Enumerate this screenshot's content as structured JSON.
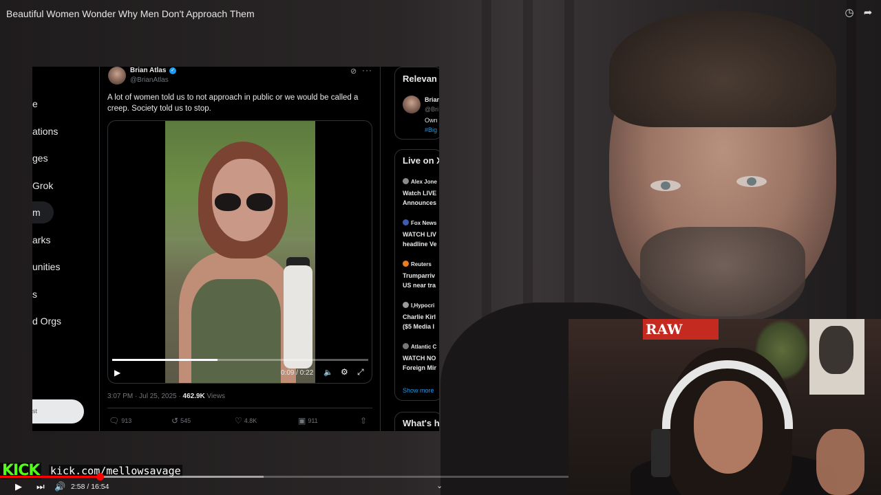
{
  "video": {
    "title": "Beautiful Women Wonder Why Men Don't Approach Them",
    "watch_later_icon": "clock-icon",
    "share_icon": "share-arrow-icon"
  },
  "x_sidebar": {
    "items": [
      "e",
      "ations",
      "ges",
      "Grok",
      "m",
      "arks",
      "unities",
      "s",
      "d Orgs"
    ],
    "post_button": "st"
  },
  "tweet": {
    "author_name": "Brian Atlas",
    "author_handle": "@BrianAtlas",
    "text": "A lot of women told us to not approach in public or we would be called a creep. Society told us to stop.",
    "video_time": "0:09 / 0:22",
    "video_progress": 0.41,
    "timestamp": "3:07 PM · Jul 25, 2025 · ",
    "views_count": "462.9K",
    "views_label": " Views",
    "replies": "913",
    "reposts": "545",
    "likes": "4.8K",
    "bookmarks": "911"
  },
  "right_column": {
    "relevant_heading": "Relevan",
    "relevant_name": "Brian",
    "relevant_handle": "@Bri",
    "relevant_bio": "Own",
    "relevant_tag": "#Big",
    "live_heading": "Live on X",
    "live_items": [
      {
        "source": "Alex Jone",
        "line1": "Watch LIVE",
        "line2": "Announces",
        "dot_color": "#8b8b8b"
      },
      {
        "source": "Fox News",
        "line1": "WATCH LIV",
        "line2": "headline Ve",
        "dot_color": "#3b5bb5"
      },
      {
        "source": "Reuters",
        "line1": "Trumparriv",
        "line2": "US near tra",
        "dot_color": "#f07b1a"
      },
      {
        "source": "I,Hypocri",
        "line1": "Charlie Kirl",
        "line2": "($5 Media I",
        "dot_color": "#9a9a9a"
      },
      {
        "source": "Atlantic C",
        "line1": "WATCH NO",
        "line2": "Foreign Mir",
        "dot_color": "#777777"
      }
    ],
    "show_more": "Show more",
    "whats_heading": "What's h"
  },
  "webcam": {
    "sign_text": "RAW"
  },
  "player": {
    "kick_logo": "KICK",
    "kick_url": "kick.com/mellowsavage",
    "time": "2:58 / 16:54",
    "played_fraction": 0.176,
    "buffered_fraction": 0.464
  },
  "colors": {
    "kick_green": "#53fc18",
    "youtube_red": "#ff0000",
    "x_blue": "#1d9bf0"
  }
}
